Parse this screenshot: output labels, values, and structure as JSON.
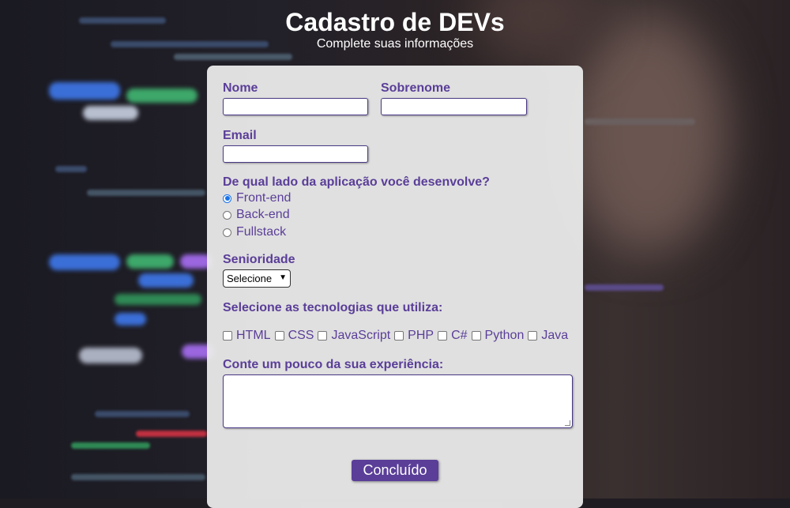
{
  "header": {
    "title": "Cadastro de DEVs",
    "subtitle": "Complete suas informações"
  },
  "form": {
    "nome_label": "Nome",
    "sobrenome_label": "Sobrenome",
    "email_label": "Email",
    "lado_question": "De qual lado da aplicação você desenvolve?",
    "lado_options": [
      {
        "label": "Front-end",
        "checked": true
      },
      {
        "label": "Back-end",
        "checked": false
      },
      {
        "label": "Fullstack",
        "checked": false
      }
    ],
    "senioridade_label": "Senioridade",
    "senioridade_selected": "Selecione",
    "tecnologias_label": "Selecione as tecnologias que utiliza:",
    "tecnologias": [
      "HTML",
      "CSS",
      "JavaScript",
      "PHP",
      "C#",
      "Python",
      "Java"
    ],
    "experiencia_label": "Conte um pouco da sua experiência:",
    "submit_label": "Concluído"
  },
  "colors": {
    "accent": "#5a3e98",
    "radio_selected": "#1a73e8"
  }
}
